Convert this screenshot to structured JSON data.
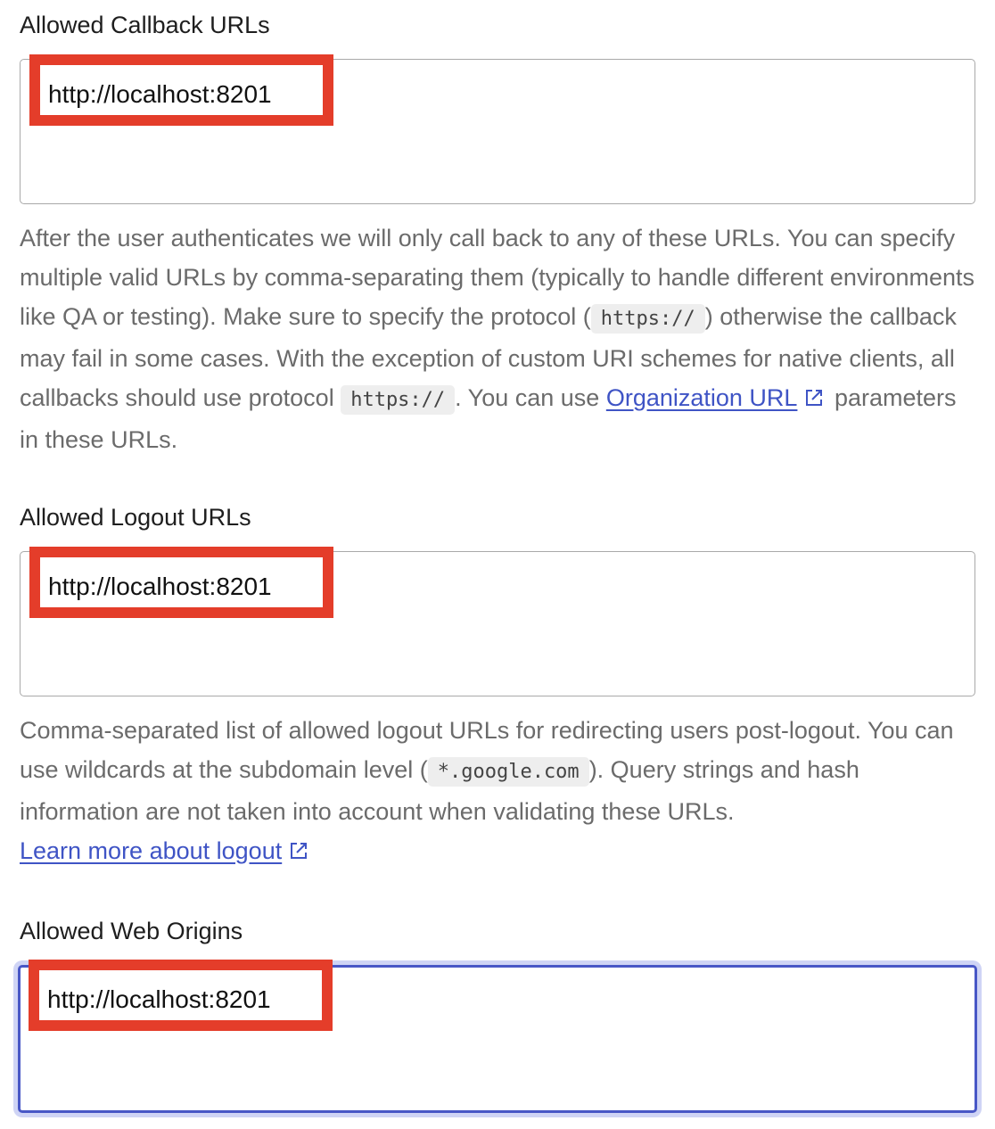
{
  "callback": {
    "label": "Allowed Callback URLs",
    "value": "http://localhost:8201",
    "help": {
      "t1": "After the user authenticates we will only call back to any of these URLs. You can specify multiple valid URLs by comma-separating them (typically to handle different environments like QA or testing). Make sure to specify the protocol (",
      "code1": "https://",
      "t2": ") otherwise the callback may fail in some cases. With the exception of custom URI schemes for native clients, all callbacks should use protocol ",
      "code2": "https://",
      "t3": ". You can use ",
      "link": "Organization URL",
      "t4": " parameters in these URLs."
    }
  },
  "logout": {
    "label": "Allowed Logout URLs",
    "value": "http://localhost:8201",
    "help": {
      "t1": "Comma-separated list of allowed logout URLs for redirecting users post-logout. You can use wildcards at the subdomain level (",
      "code1": "*.google.com",
      "t2": "). Query strings and hash information are not taken into account when validating these URLs.",
      "link": "Learn more about logout"
    }
  },
  "web_origins": {
    "label": "Allowed Web Origins",
    "value": "http://localhost:8201"
  },
  "colors": {
    "highlight": "#e43d2a",
    "link": "#3f54c5",
    "focus": "#4857c6"
  },
  "icons": {
    "external_link": "external-link-icon"
  }
}
